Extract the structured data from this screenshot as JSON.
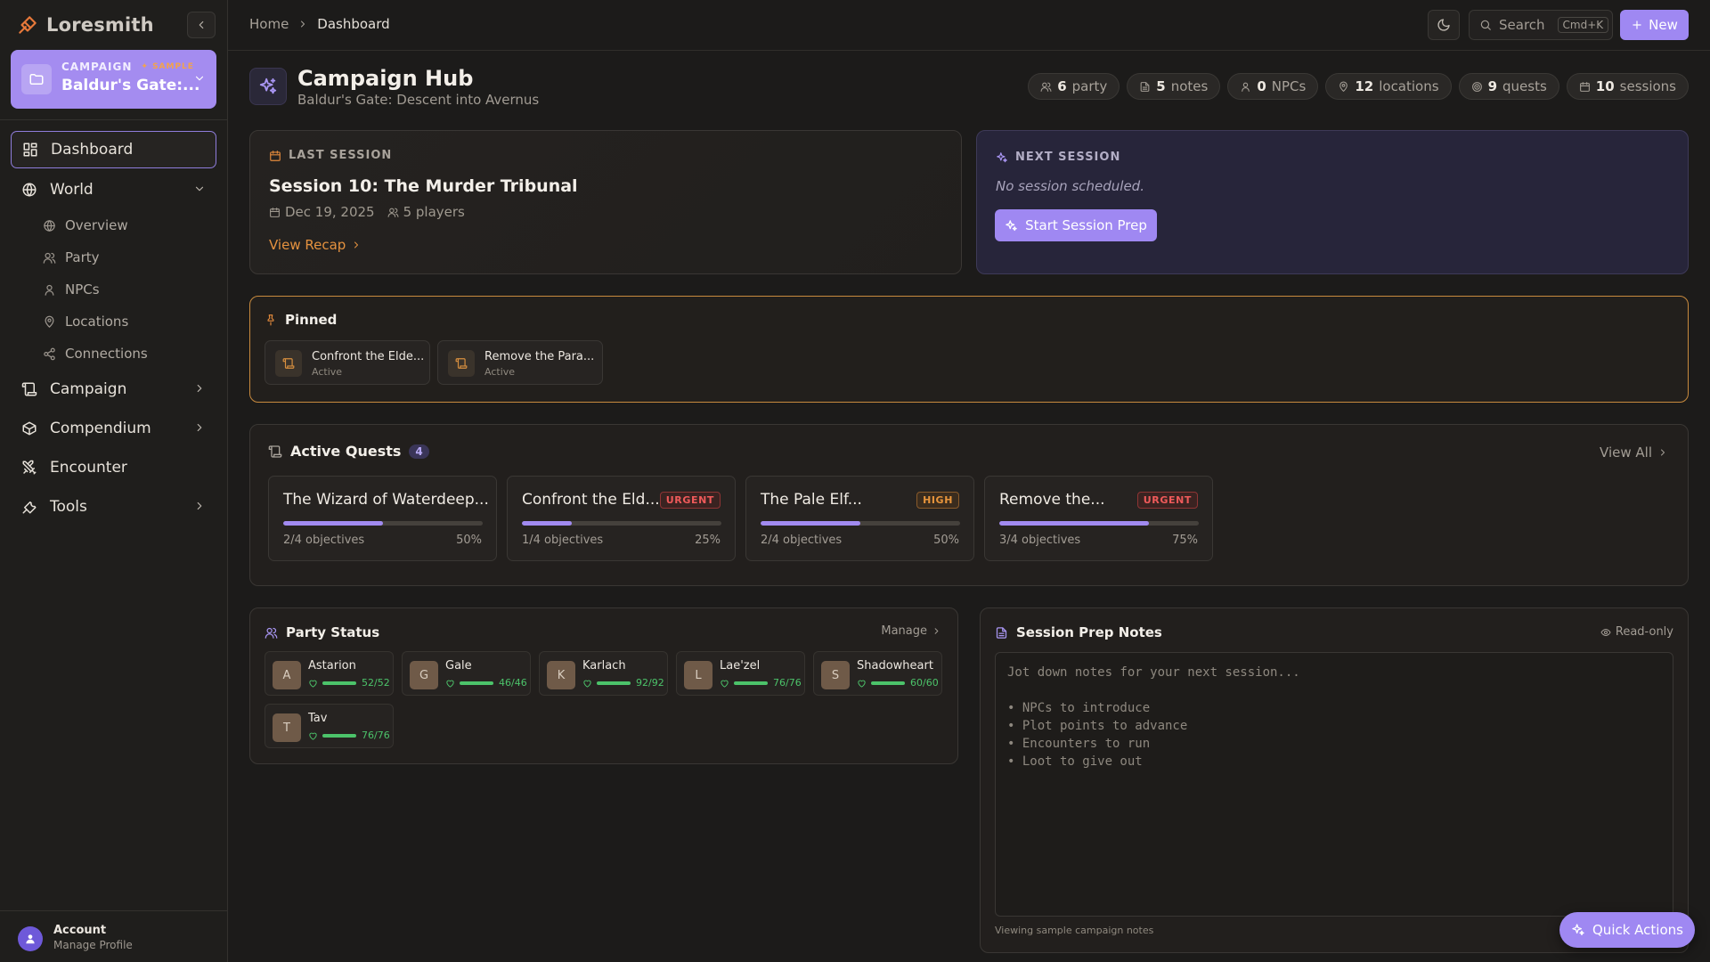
{
  "app": {
    "name": "Loresmith"
  },
  "campaign": {
    "label": "CAMPAIGN",
    "sample_tag": "SAMPLE",
    "name": "Baldur's Gate:..."
  },
  "sidebar": {
    "dashboard": "Dashboard",
    "world": "World",
    "world_items": [
      "Overview",
      "Party",
      "NPCs",
      "Locations",
      "Connections"
    ],
    "campaign": "Campaign",
    "compendium": "Compendium",
    "encounter": "Encounter",
    "tools": "Tools"
  },
  "account": {
    "title": "Account",
    "subtitle": "Manage Profile"
  },
  "topbar": {
    "breadcrumb": [
      "Home",
      "Dashboard"
    ],
    "search_label": "Search",
    "search_shortcut": "Cmd+K",
    "new_label": "New"
  },
  "header": {
    "title": "Campaign Hub",
    "subtitle": "Baldur's Gate: Descent into Avernus",
    "stats": [
      {
        "count": "6",
        "label": "party",
        "icon": "users-icon"
      },
      {
        "count": "5",
        "label": "notes",
        "icon": "file-icon"
      },
      {
        "count": "0",
        "label": "NPCs",
        "icon": "user-icon"
      },
      {
        "count": "12",
        "label": "locations",
        "icon": "map-pin-icon"
      },
      {
        "count": "9",
        "label": "quests",
        "icon": "target-icon"
      },
      {
        "count": "10",
        "label": "sessions",
        "icon": "calendar-icon"
      }
    ]
  },
  "last_session": {
    "label": "LAST SESSION",
    "title": "Session 10: The Murder Tribunal",
    "date": "Dec 19, 2025",
    "players": "5 players",
    "link": "View Recap"
  },
  "next_session": {
    "label": "NEXT SESSION",
    "empty": "No session scheduled.",
    "button": "Start Session Prep"
  },
  "pinned": {
    "title": "Pinned",
    "items": [
      {
        "name": "Confront the Elde...",
        "status": "Active"
      },
      {
        "name": "Remove the Para...",
        "status": "Active"
      }
    ]
  },
  "quests": {
    "title": "Active Quests",
    "count": "4",
    "view_all": "View All",
    "items": [
      {
        "name": "The Wizard of Waterdeep...",
        "badge": "",
        "objectives": "2/4 objectives",
        "percent": "50%",
        "progress": 0.5
      },
      {
        "name": "Confront the Eld...",
        "badge": "URGENT",
        "objectives": "1/4 objectives",
        "percent": "25%",
        "progress": 0.25
      },
      {
        "name": "The Pale Elf...",
        "badge": "HIGH",
        "objectives": "2/4 objectives",
        "percent": "50%",
        "progress": 0.5
      },
      {
        "name": "Remove the...",
        "badge": "URGENT",
        "objectives": "3/4 objectives",
        "percent": "75%",
        "progress": 0.75
      }
    ]
  },
  "party": {
    "title": "Party Status",
    "manage": "Manage",
    "members": [
      {
        "initial": "A",
        "name": "Astarion",
        "hp_text": "52/52",
        "hp": 1.0
      },
      {
        "initial": "G",
        "name": "Gale",
        "hp_text": "46/46",
        "hp": 1.0
      },
      {
        "initial": "K",
        "name": "Karlach",
        "hp_text": "92/92",
        "hp": 1.0
      },
      {
        "initial": "L",
        "name": "Lae'zel",
        "hp_text": "76/76",
        "hp": 1.0
      },
      {
        "initial": "S",
        "name": "Shadowheart",
        "hp_text": "60/60",
        "hp": 1.0
      },
      {
        "initial": "T",
        "name": "Tav",
        "hp_text": "76/76",
        "hp": 1.0
      }
    ]
  },
  "notes": {
    "title": "Session Prep Notes",
    "readonly": "Read-only",
    "placeholder": "Jot down notes for your next session...\n\n• NPCs to introduce\n• Plot points to advance\n• Encounters to run\n• Loot to give out",
    "footer": "Viewing sample campaign notes"
  },
  "quick_actions": "Quick Actions",
  "colors": {
    "accent": "#9f88f2",
    "orange": "#e5923f",
    "hp_green": "#4cc36a",
    "urgent": "#ef5a5a"
  }
}
